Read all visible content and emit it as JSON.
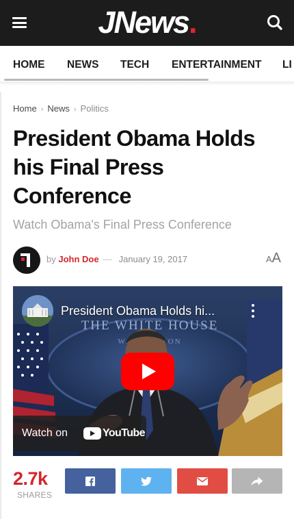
{
  "header": {
    "logo_text": "JNews",
    "logo_dot": ".",
    "menu_icon": "hamburger-menu-icon",
    "search_icon": "search-icon",
    "background_color": "#1c1c1c",
    "accent_color": "#e3232c"
  },
  "nav": {
    "items": [
      "HOME",
      "NEWS",
      "TECH",
      "ENTERTAINMENT",
      "LI"
    ]
  },
  "breadcrumb": {
    "items": [
      "Home",
      "News",
      "Politics"
    ]
  },
  "article": {
    "title": "President Obama Holds his Final Press Conference",
    "subtitle": "Watch Obama's Final Press Conference",
    "by_label": "by",
    "author": "John Doe",
    "dash": "—",
    "date": "January 19, 2017",
    "font_toggle_small": "A",
    "font_toggle_large": "A"
  },
  "video": {
    "title": "President Obama Holds hi...",
    "watch_on": "Watch on",
    "platform": "YouTube",
    "play_icon": "play-icon",
    "menu_icon": "kebab-menu-icon"
  },
  "share": {
    "count": "2.7k",
    "label": "SHARES",
    "buttons": [
      {
        "network": "facebook",
        "icon": "facebook-icon",
        "color": "#45629f"
      },
      {
        "network": "twitter",
        "icon": "twitter-icon",
        "color": "#5eb2ef"
      },
      {
        "network": "email",
        "icon": "envelope-icon",
        "color": "#e14d43"
      },
      {
        "network": "more",
        "icon": "share-arrow-icon",
        "color": "#b5b5b5"
      }
    ]
  }
}
